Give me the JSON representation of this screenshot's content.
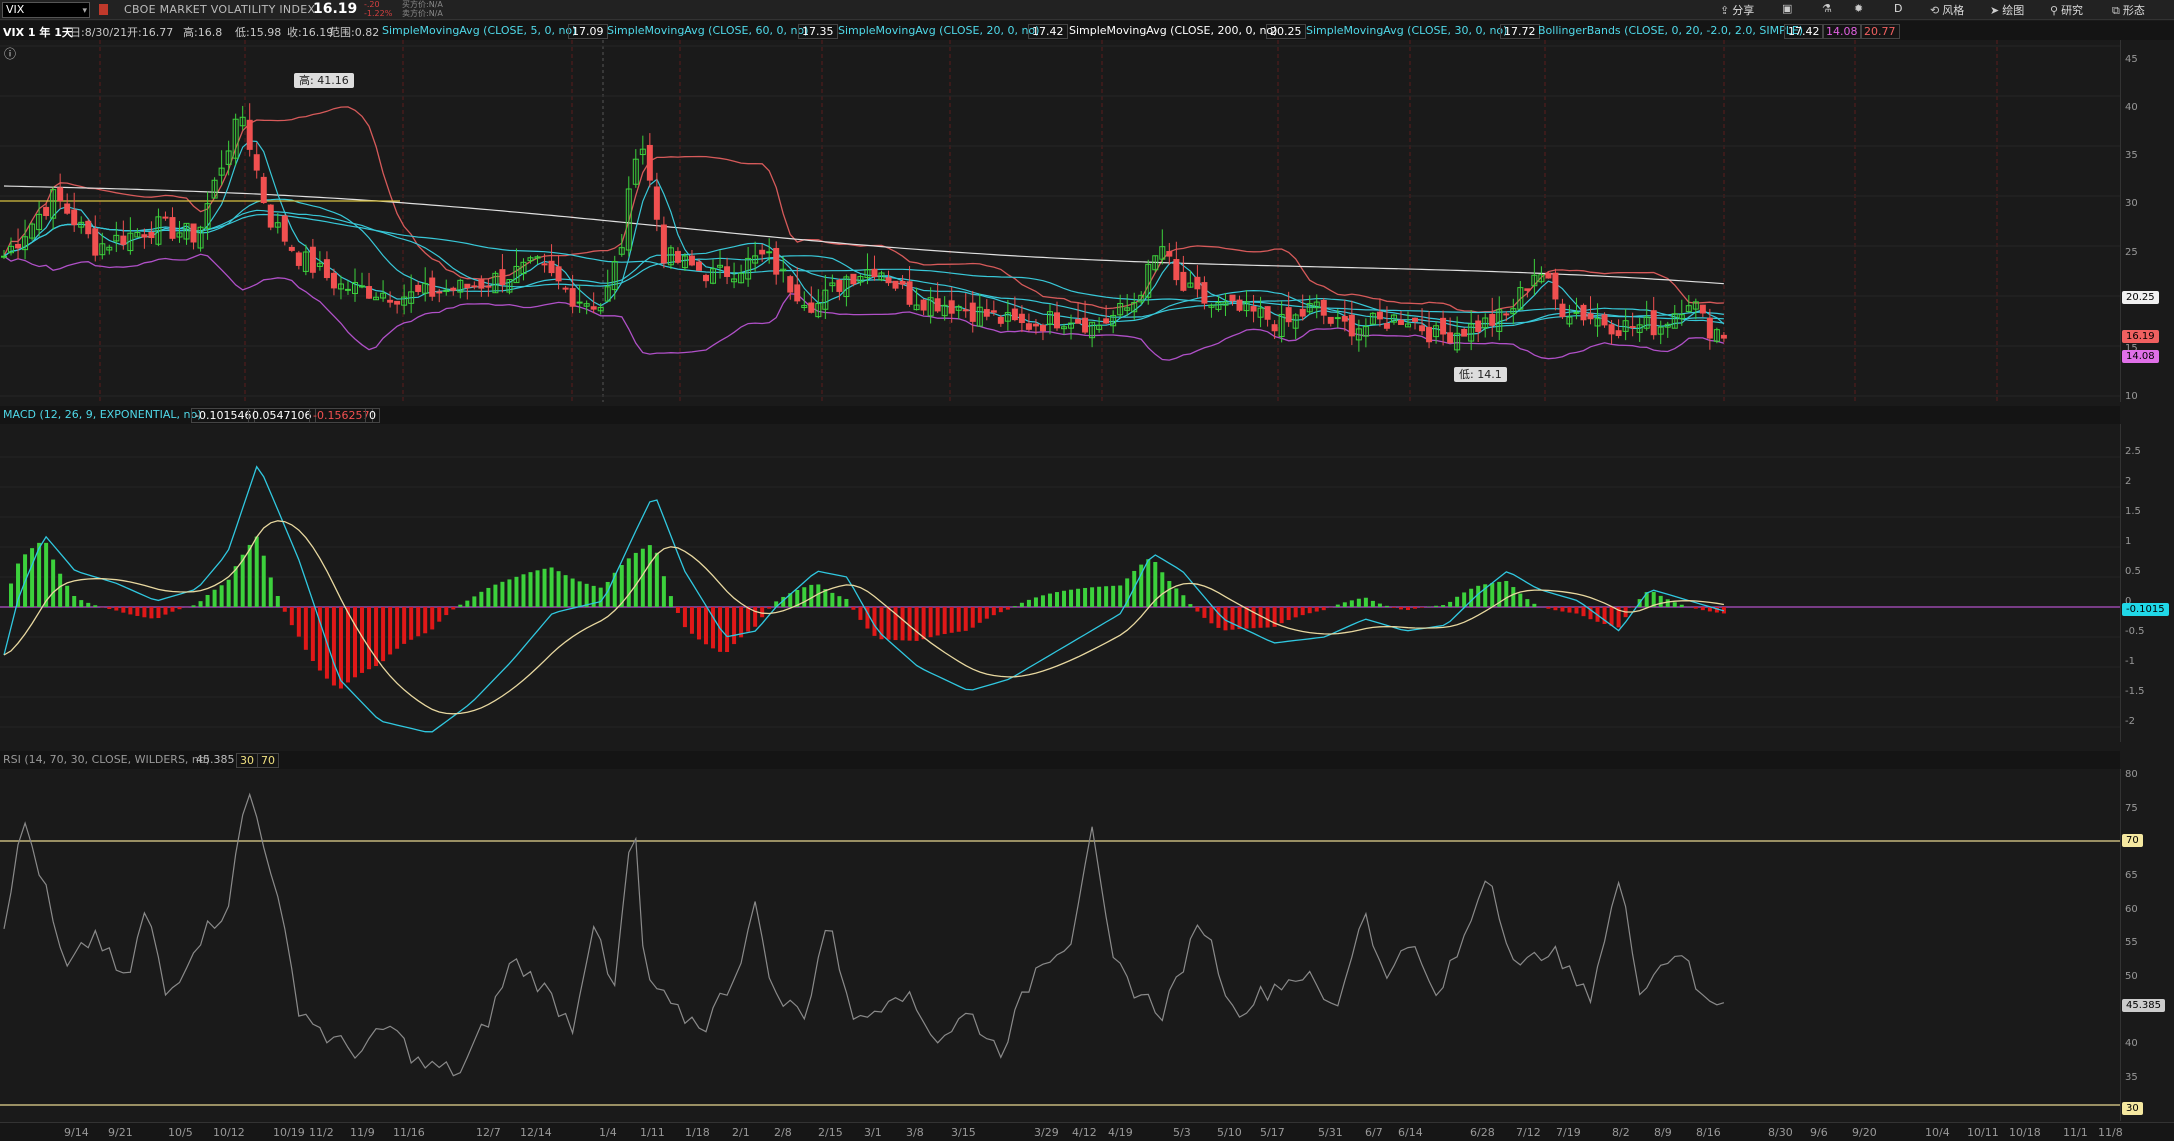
{
  "toolbar": {
    "symbol": "VIX",
    "description": "CBOE MARKET VOLATILITY INDEX",
    "last": "16.19",
    "change": "-.20",
    "change_pct": "-1.22%",
    "bid": "买方价:N/A",
    "ask": "卖方价:N/A",
    "items": [
      {
        "icon": "share-icon",
        "label": "分享"
      },
      {
        "icon": "chart-settings-icon",
        "label": ""
      },
      {
        "icon": "flask-icon",
        "label": ""
      },
      {
        "icon": "gear-icon",
        "label": ""
      },
      {
        "icon": "period-icon",
        "label": "D"
      },
      {
        "icon": "style-icon",
        "label": "风格"
      },
      {
        "icon": "drawing-icon",
        "label": "绘图"
      },
      {
        "icon": "studies-icon",
        "label": "研究"
      },
      {
        "icon": "patterns-icon",
        "label": "形态"
      }
    ]
  },
  "info": {
    "title": "VIX 1 年 1天",
    "date": "日:8/30/21",
    "open": "开:16.77",
    "high": "高:16.8",
    "low": "低:15.98",
    "close": "收:16.19",
    "range": "范围:0.82",
    "studies": [
      {
        "label": "SimpleMovingAvg (CLOSE, 5, 0, no)",
        "value": "17.09",
        "color": "#4fd8e8"
      },
      {
        "label": "SimpleMovingAvg (CLOSE, 60, 0, no)",
        "value": "17.35",
        "color": "#4fd8e8"
      },
      {
        "label": "SimpleMovingAvg (CLOSE, 20, 0, no)",
        "value": "17.42",
        "color": "#4fd8e8"
      },
      {
        "label": "SimpleMovingAvg (CLOSE, 200, 0, no)",
        "value": "20.25",
        "color": "#ffffff"
      },
      {
        "label": "SimpleMovingAvg (CLOSE, 30, 0, no)",
        "value": "17.72",
        "color": "#4fd8e8"
      },
      {
        "label": "BollingerBands (CLOSE, 0, 20, -2.0, 2.0, SIMPLE)",
        "value": "17.42",
        "color": "#4fd8e8"
      }
    ],
    "bb_lower": "14.08",
    "bb_upper": "20.77"
  },
  "price_panel": {
    "y_ticks": [
      "45",
      "40",
      "35",
      "30",
      "25",
      "20",
      "15",
      "10"
    ],
    "high_callout": "高: 41.16",
    "low_callout": "低: 14.1",
    "tag_sma200": "20.25",
    "tag_last": "16.19",
    "tag_bb_lower": "14.08",
    "colors": {
      "up": "#3cd13c",
      "down": "#f05050",
      "sma200": "#e8e8e8",
      "sma": "#4fd8e8",
      "bb_upper": "#e86464",
      "bb_lower": "#c060d8"
    }
  },
  "macd_panel": {
    "header": "MACD (12, 26, 9, EXPONENTIAL, no)",
    "value": "-0.101546",
    "avg": "0.0547106",
    "diff": "-0.156257",
    "zero": "0",
    "y_ticks": [
      "2.5",
      "2",
      "1.5",
      "1",
      "0.5",
      "0",
      "-0.5",
      "-1",
      "-1.5",
      "-2"
    ],
    "tag": "-0.1015"
  },
  "rsi_panel": {
    "header": "RSI (14, 70, 30, CLOSE, WILDERS, no)",
    "value": "45.385",
    "ob": "30",
    "os": "70",
    "y_ticks": [
      "80",
      "75",
      "70",
      "65",
      "60",
      "55",
      "50",
      "45",
      "40",
      "35",
      "30"
    ],
    "tag_value": "45.385",
    "tag_70": "70",
    "tag_30": "30"
  },
  "x_axis": {
    "labels": [
      "9/14",
      "9/21",
      "10/5",
      "10/12",
      "10/19",
      "11/2",
      "11/9",
      "11/16",
      "12/7",
      "12/14",
      "1/4",
      "1/11",
      "1/18",
      "2/1",
      "2/8",
      "2/15",
      "3/1",
      "3/8",
      "3/15",
      "3/29",
      "4/12",
      "4/19",
      "5/3",
      "5/10",
      "5/17",
      "5/31",
      "6/7",
      "6/14",
      "6/28",
      "7/12",
      "7/19",
      "8/2",
      "8/9",
      "8/16",
      "8/30",
      "9/6",
      "9/20",
      "10/4",
      "10/11",
      "10/18",
      "11/1",
      "11/8"
    ]
  }
}
